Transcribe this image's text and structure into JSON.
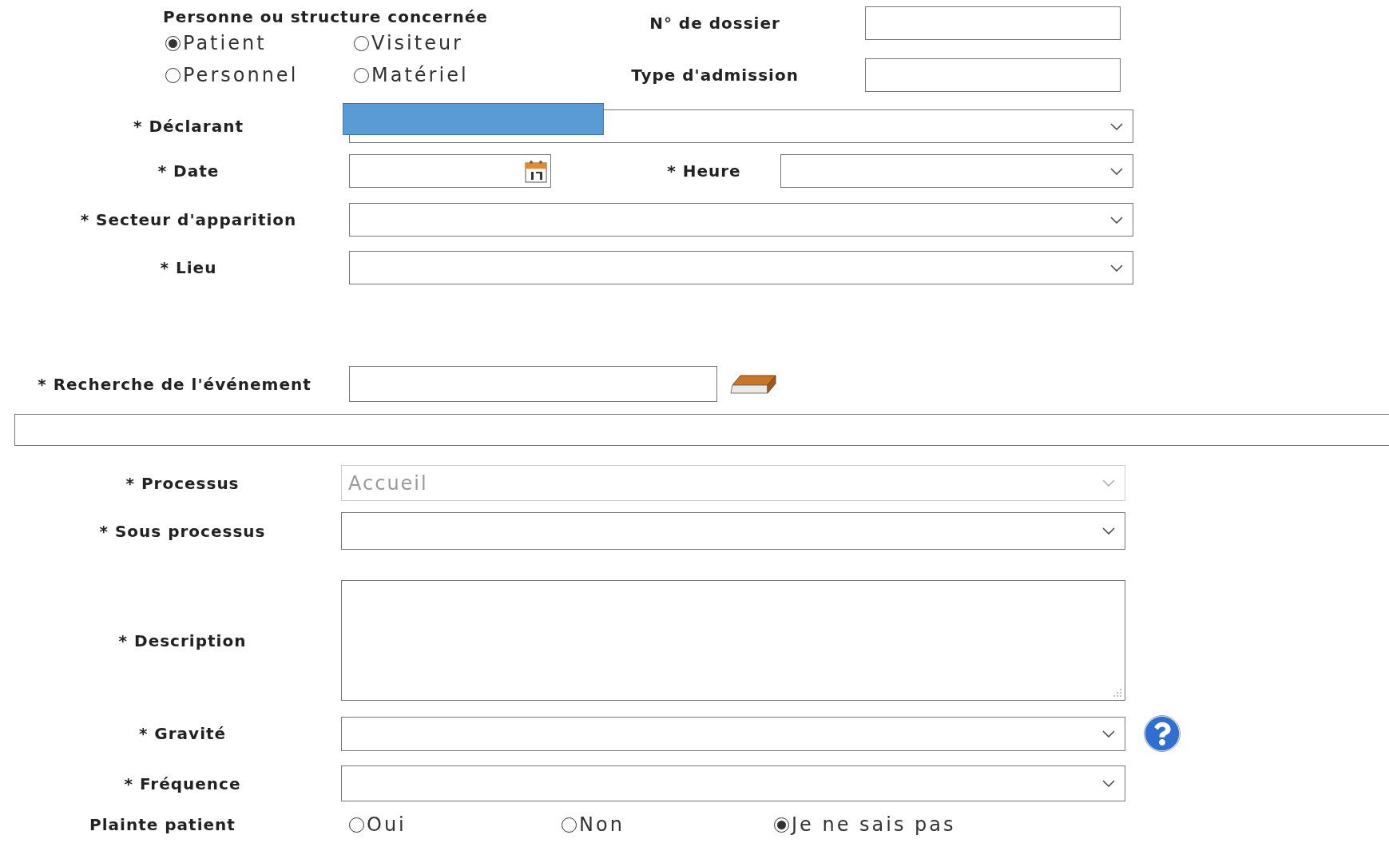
{
  "person": {
    "title": "Personne ou structure concernée",
    "options": [
      {
        "label": "Patient",
        "selected": true
      },
      {
        "label": "Visiteur",
        "selected": false
      },
      {
        "label": "Personnel",
        "selected": false
      },
      {
        "label": "Matériel",
        "selected": false
      }
    ]
  },
  "dossier": {
    "label": "N° de dossier"
  },
  "admission": {
    "label": "Type d'admission"
  },
  "declarant": {
    "label": "* Déclarant",
    "redacted": true
  },
  "date": {
    "label": "* Date"
  },
  "heure": {
    "label": "* Heure"
  },
  "secteur": {
    "label": "* Secteur d'apparition"
  },
  "lieu": {
    "label": "* Lieu"
  },
  "recherche": {
    "label": "* Recherche de l'événement"
  },
  "processus": {
    "label": "* Processus",
    "value": "Accueil",
    "disabled": true
  },
  "sous_processus": {
    "label": "* Sous processus"
  },
  "description": {
    "label": "* Description"
  },
  "gravite": {
    "label": "* Gravité"
  },
  "frequence": {
    "label": "* Fréquence"
  },
  "plainte": {
    "label": "Plainte patient",
    "options": [
      {
        "label": "Oui",
        "selected": false
      },
      {
        "label": "Non",
        "selected": false
      },
      {
        "label": "Je ne sais pas",
        "selected": true
      }
    ]
  }
}
